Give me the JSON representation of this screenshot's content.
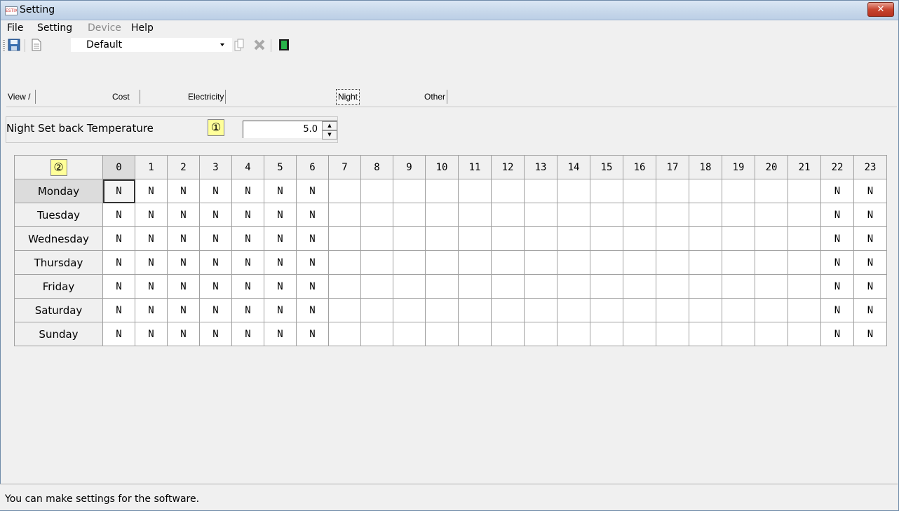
{
  "window": {
    "title": "Setting",
    "app_icon_text": "ESTIX",
    "close_symbol": "✕"
  },
  "menu": [
    {
      "label": "File",
      "enabled": true
    },
    {
      "label": "Setting",
      "enabled": true
    },
    {
      "label": "Device",
      "enabled": false
    },
    {
      "label": "Help",
      "enabled": true
    }
  ],
  "toolbar": {
    "profile_value": "Default"
  },
  "tabs": [
    {
      "label": "View / Unit Setting",
      "active": false
    },
    {
      "label": "Cost Setting",
      "active": false
    },
    {
      "label": "Electricity Expense Setting",
      "active": false
    },
    {
      "label": "Night Set Back",
      "active": true
    },
    {
      "label": "Other Fuel",
      "active": false
    }
  ],
  "night_setback": {
    "label": "Night Set back Temperature",
    "marker": "①",
    "value": "5.0"
  },
  "schedule": {
    "corner_marker": "②",
    "hours": [
      "0",
      "1",
      "2",
      "3",
      "4",
      "5",
      "6",
      "7",
      "8",
      "9",
      "10",
      "11",
      "12",
      "13",
      "14",
      "15",
      "16",
      "17",
      "18",
      "19",
      "20",
      "21",
      "22",
      "23"
    ],
    "rows": [
      {
        "day": "Monday",
        "cells": [
          "N",
          "N",
          "N",
          "N",
          "N",
          "N",
          "N",
          "",
          "",
          "",
          "",
          "",
          "",
          "",
          "",
          "",
          "",
          "",
          "",
          "",
          "",
          "",
          "N",
          "N"
        ]
      },
      {
        "day": "Tuesday",
        "cells": [
          "N",
          "N",
          "N",
          "N",
          "N",
          "N",
          "N",
          "",
          "",
          "",
          "",
          "",
          "",
          "",
          "",
          "",
          "",
          "",
          "",
          "",
          "",
          "",
          "N",
          "N"
        ]
      },
      {
        "day": "Wednesday",
        "cells": [
          "N",
          "N",
          "N",
          "N",
          "N",
          "N",
          "N",
          "",
          "",
          "",
          "",
          "",
          "",
          "",
          "",
          "",
          "",
          "",
          "",
          "",
          "",
          "",
          "N",
          "N"
        ]
      },
      {
        "day": "Thursday",
        "cells": [
          "N",
          "N",
          "N",
          "N",
          "N",
          "N",
          "N",
          "",
          "",
          "",
          "",
          "",
          "",
          "",
          "",
          "",
          "",
          "",
          "",
          "",
          "",
          "",
          "N",
          "N"
        ]
      },
      {
        "day": "Friday",
        "cells": [
          "N",
          "N",
          "N",
          "N",
          "N",
          "N",
          "N",
          "",
          "",
          "",
          "",
          "",
          "",
          "",
          "",
          "",
          "",
          "",
          "",
          "",
          "",
          "",
          "N",
          "N"
        ]
      },
      {
        "day": "Saturday",
        "cells": [
          "N",
          "N",
          "N",
          "N",
          "N",
          "N",
          "N",
          "",
          "",
          "",
          "",
          "",
          "",
          "",
          "",
          "",
          "",
          "",
          "",
          "",
          "",
          "",
          "N",
          "N"
        ]
      },
      {
        "day": "Sunday",
        "cells": [
          "N",
          "N",
          "N",
          "N",
          "N",
          "N",
          "N",
          "",
          "",
          "",
          "",
          "",
          "",
          "",
          "",
          "",
          "",
          "",
          "",
          "",
          "",
          "",
          "N",
          "N"
        ]
      }
    ]
  },
  "status": {
    "text": "You can make settings for the software."
  },
  "colors": {
    "marker_bg": "#ffff99",
    "close_red": "#c8452f",
    "titlebar": "#c6d7ea"
  }
}
